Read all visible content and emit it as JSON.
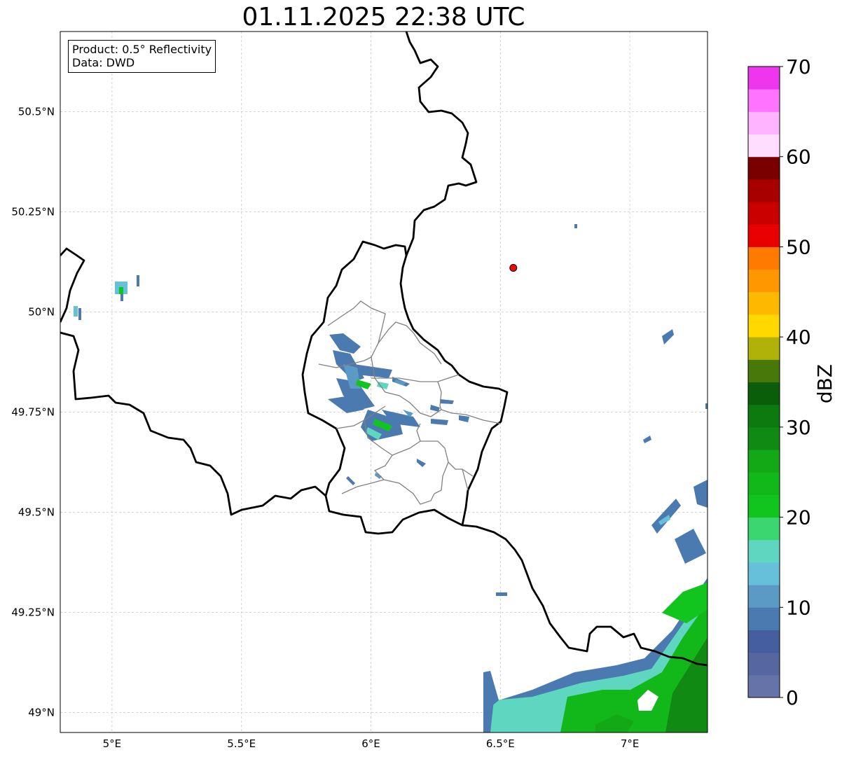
{
  "title": "01.11.2025 22:38 UTC",
  "info": {
    "product": "Product: 0.5° Reflectivity",
    "data": "Data: DWD"
  },
  "map": {
    "lon_range": [
      4.8,
      7.3
    ],
    "lat_range": [
      48.95,
      50.7
    ],
    "x_ticks": [
      {
        "lon": 5.0,
        "label": "5°E"
      },
      {
        "lon": 5.5,
        "label": "5.5°E"
      },
      {
        "lon": 6.0,
        "label": "6°E"
      },
      {
        "lon": 6.5,
        "label": "6.5°E"
      },
      {
        "lon": 7.0,
        "label": "7°E"
      }
    ],
    "y_ticks": [
      {
        "lat": 50.5,
        "label": "50.5°N"
      },
      {
        "lat": 50.25,
        "label": "50.25°N"
      },
      {
        "lat": 50.0,
        "label": "50°N"
      },
      {
        "lat": 49.75,
        "label": "49.75°N"
      },
      {
        "lat": 49.5,
        "label": "49.5°N"
      },
      {
        "lat": 49.25,
        "label": "49.25°N"
      },
      {
        "lat": 49.0,
        "label": "49°N"
      }
    ],
    "grid": true,
    "radar_site": {
      "lon": 6.55,
      "lat": 50.11,
      "color": "#ff0000"
    }
  },
  "colorbar": {
    "label": "dBZ",
    "min": 0,
    "max": 70,
    "ticks": [
      "0",
      "10",
      "20",
      "30",
      "40",
      "50",
      "60",
      "70"
    ],
    "colors": [
      "#6673a8",
      "#5566a0",
      "#455ea0",
      "#4a7ab0",
      "#5a9ac4",
      "#66c0da",
      "#5ed6c0",
      "#3cd670",
      "#12c41e",
      "#12b81a",
      "#12a816",
      "#108a12",
      "#0c7a0e",
      "#0a5e0a",
      "#48780a",
      "#b0b20a",
      "#ffd800",
      "#ffb800",
      "#ff9800",
      "#ff7a00",
      "#e80000",
      "#c80000",
      "#a80000",
      "#7a0000",
      "#ffddff",
      "#ffb4ff",
      "#ff74ff",
      "#ee36ee"
    ]
  }
}
